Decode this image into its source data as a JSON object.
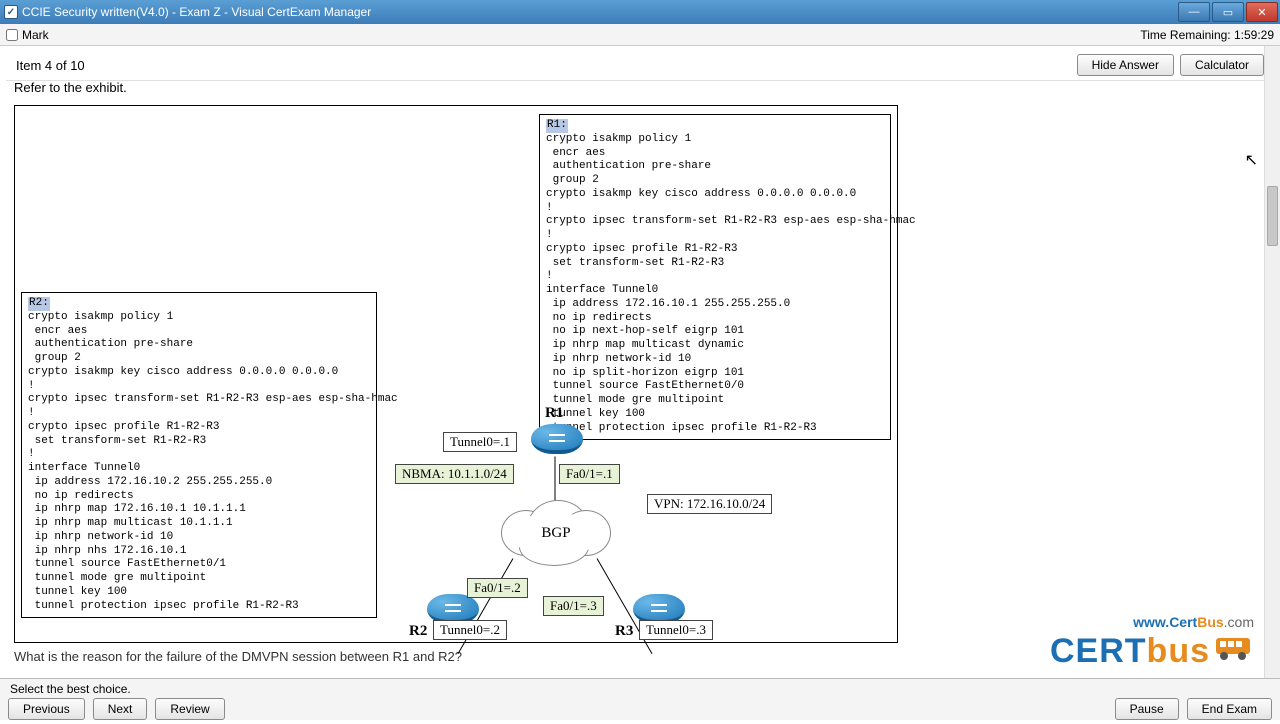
{
  "window": {
    "title": "CCIE Security written(V4.0) - Exam Z - Visual CertExam Manager"
  },
  "top": {
    "mark": "Mark",
    "time": "Time Remaining: 1:59:29"
  },
  "header": {
    "item": "Item 4 of 10",
    "hide": "Hide Answer",
    "calc": "Calculator"
  },
  "question": {
    "refer": "Refer to the exhibit.",
    "cut": "What is the reason for the failure of the DMVPN session between R1 and R2?"
  },
  "exhibit": {
    "r1_hdr": "R1:",
    "r1_cfg": "crypto isakmp policy 1\n encr aes\n authentication pre-share\n group 2\ncrypto isakmp key cisco address 0.0.0.0 0.0.0.0\n!\ncrypto ipsec transform-set R1-R2-R3 esp-aes esp-sha-hmac\n!\ncrypto ipsec profile R1-R2-R3\n set transform-set R1-R2-R3\n!\ninterface Tunnel0\n ip address 172.16.10.1 255.255.255.0\n no ip redirects\n no ip next-hop-self eigrp 101\n ip nhrp map multicast dynamic\n ip nhrp network-id 10\n no ip split-horizon eigrp 101\n tunnel source FastEthernet0/0\n tunnel mode gre multipoint\n tunnel key 100\n tunnel protection ipsec profile R1-R2-R3",
    "r2_hdr": "R2:",
    "r2_cfg": "crypto isakmp policy 1\n encr aes\n authentication pre-share\n group 2\ncrypto isakmp key cisco address 0.0.0.0 0.0.0.0\n!\ncrypto ipsec transform-set R1-R2-R3 esp-aes esp-sha-hmac\n!\ncrypto ipsec profile R1-R2-R3\n set transform-set R1-R2-R3\n!\ninterface Tunnel0\n ip address 172.16.10.2 255.255.255.0\n no ip redirects\n ip nhrp map 172.16.10.1 10.1.1.1\n ip nhrp map multicast 10.1.1.1\n ip nhrp network-id 10\n ip nhrp nhs 172.16.10.1\n tunnel source FastEthernet0/1\n tunnel mode gre multipoint\n tunnel key 100\n tunnel protection ipsec profile R1-R2-R3",
    "labels": {
      "r1": "R1",
      "r2": "R2",
      "r3": "R3",
      "bgp": "BGP",
      "t0_1": "Tunnel0=.1",
      "nbma": "NBMA: 10.1.1.0/24",
      "fa01_1": "Fa0/1=.1",
      "vpn": "VPN: 172.16.10.0/24",
      "fa01_2": "Fa0/1=.2",
      "fa01_3": "Fa0/1=.3",
      "t0_2": "Tunnel0=.2",
      "t0_3": "Tunnel0=.3"
    }
  },
  "footer": {
    "instr": "Select the best choice.",
    "prev": "Previous",
    "next": "Next",
    "review": "Review",
    "pause": "Pause",
    "end": "End Exam"
  },
  "logo": {
    "www": "www.",
    "cert": "Cert",
    "bus": "Bus",
    "com": ".com",
    "big_c": "CERT",
    "big_b": "bus"
  }
}
